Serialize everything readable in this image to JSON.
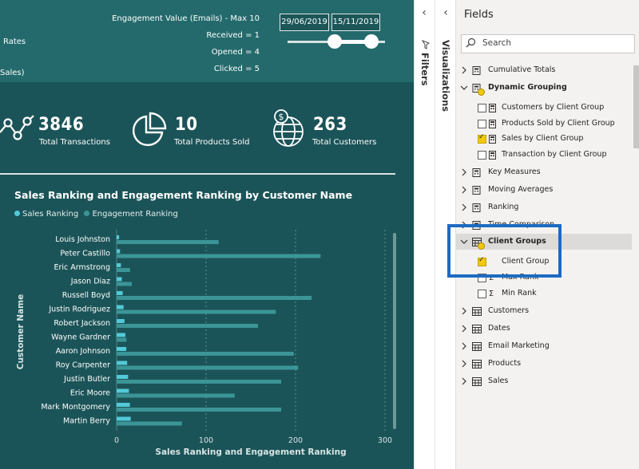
{
  "header": {
    "partial_left_1": "Rates",
    "partial_left_2": "Sales)",
    "engagement_title": "Engagement Value (Emails) - Max 10",
    "received": "Received = 1",
    "opened": "Opened = 4",
    "clicked": "Clicked = 5",
    "date_start": "29/06/2019",
    "date_end": "15/11/2019",
    "slider_range": [
      0.5,
      0.9
    ]
  },
  "kpis": [
    {
      "value": "3846",
      "label": "Total Transactions",
      "icon": "network-nodes-icon"
    },
    {
      "value": "10",
      "label": "Total Products Sold",
      "icon": "pie-chart-icon"
    },
    {
      "value": "263",
      "label": "Total Customers",
      "icon": "globe-dollar-icon"
    }
  ],
  "chart_data": {
    "type": "bar",
    "orientation": "horizontal",
    "title": "Sales Ranking and Engagement Ranking by Customer Name",
    "xlabel": "Sales Ranking and Engagement Ranking",
    "ylabel": "Customer Name",
    "xlim": [
      0,
      300
    ],
    "xticks": [
      0,
      100,
      200,
      300
    ],
    "grid": true,
    "legend_position": "top-left",
    "categories": [
      "Louis Johnston",
      "Peter Castillo",
      "Eric Armstrong",
      "Jason Diaz",
      "Russell Boyd",
      "Justin Rodriguez",
      "Robert Jackson",
      "Wayne Gardner",
      "Aaron Johnson",
      "Roy Carpenter",
      "Justin Butler",
      "Eric Moore",
      "Mark Montgomery",
      "Martin Berry"
    ],
    "series": [
      {
        "name": "Sales Ranking",
        "color": "#53c9d8",
        "values": [
          1,
          2,
          3,
          4,
          5,
          6,
          7,
          8,
          9,
          10,
          11,
          12,
          13,
          14
        ]
      },
      {
        "name": "Engagement Ranking",
        "color": "#3b9596",
        "values": [
          114,
          228,
          15,
          17,
          218,
          178,
          158,
          11,
          198,
          203,
          184,
          132,
          184,
          73
        ]
      }
    ]
  },
  "panes": {
    "filters_label": "Filters",
    "visualizations_label": "Visualizations",
    "fields_title": "Fields",
    "search_placeholder": "Search"
  },
  "fields_tree": [
    {
      "label": "Cumulative Totals",
      "level": 0,
      "expanded": false,
      "type": "measure-table"
    },
    {
      "label": "Dynamic Grouping",
      "level": 0,
      "expanded": true,
      "type": "measure-table",
      "bold": true,
      "badge": true
    },
    {
      "label": "Customers by Client Group",
      "level": 1,
      "type": "measure",
      "checked": false
    },
    {
      "label": "Products Sold by Client Group",
      "level": 1,
      "type": "measure",
      "checked": false
    },
    {
      "label": "Sales by Client Group",
      "level": 1,
      "type": "measure",
      "checked": true
    },
    {
      "label": "Transaction by Client Group",
      "level": 1,
      "type": "measure",
      "checked": false
    },
    {
      "label": "Key Measures",
      "level": 0,
      "expanded": false,
      "type": "measure-table"
    },
    {
      "label": "Moving Averages",
      "level": 0,
      "expanded": false,
      "type": "measure-table"
    },
    {
      "label": "Ranking",
      "level": 0,
      "expanded": false,
      "type": "measure-table"
    },
    {
      "label": "Time Comparison",
      "level": 0,
      "expanded": false,
      "type": "measure-table"
    },
    {
      "label": "Client Groups",
      "level": 0,
      "expanded": true,
      "type": "table",
      "bold": true,
      "badge": true,
      "selected": true
    },
    {
      "label": "Client Group",
      "level": 1,
      "type": "field",
      "checked": true
    },
    {
      "label": "Max Rank",
      "level": 1,
      "type": "sum",
      "checked": false
    },
    {
      "label": "Min Rank",
      "level": 1,
      "type": "sum",
      "checked": false
    },
    {
      "label": "Customers",
      "level": 0,
      "expanded": false,
      "type": "table"
    },
    {
      "label": "Dates",
      "level": 0,
      "expanded": false,
      "type": "table"
    },
    {
      "label": "Email Marketing",
      "level": 0,
      "expanded": false,
      "type": "table"
    },
    {
      "label": "Products",
      "level": 0,
      "expanded": false,
      "type": "table"
    },
    {
      "label": "Sales",
      "level": 0,
      "expanded": false,
      "type": "table"
    }
  ],
  "colors": {
    "report_bg": "#1b5458",
    "header_bg": "#246a6c",
    "highlight_box": "#1d6bc2",
    "checkbox_checked": "#f2c811"
  }
}
